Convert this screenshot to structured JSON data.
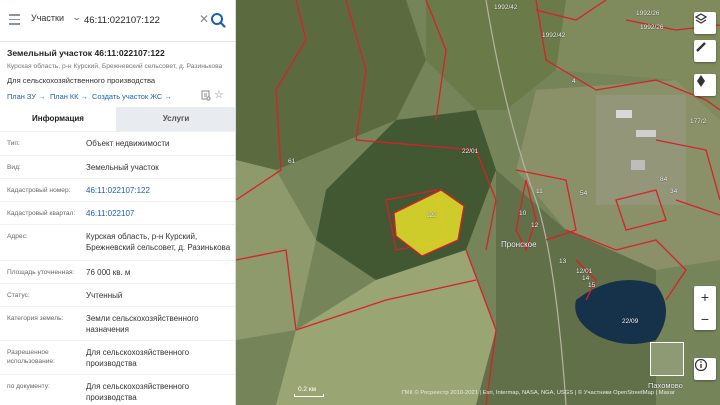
{
  "search": {
    "layer": "Участки",
    "query": "46:11:022107:122"
  },
  "object": {
    "title": "Земельный участок 46:11:022107:122",
    "address": "Курская область, р-н Курский, Брежневский сельсовет, д. Разинькова",
    "purpose": "Для сельскохозяйственного производства",
    "links": [
      "План ЗУ →",
      "План КК →",
      "Создать участок ЖС →"
    ]
  },
  "tabs": [
    "Информация",
    "Услуги"
  ],
  "properties": [
    {
      "label": "Тип:",
      "value": "Объект недвижимости"
    },
    {
      "label": "Вид:",
      "value": "Земельный участок"
    },
    {
      "label": "Кадастровый номер:",
      "value": "46:11:022107:122"
    },
    {
      "label": "Кадастровый квартал:",
      "value": "46:11:022107"
    },
    {
      "label": "Адрес:",
      "value": "Курская область, р-н Курский, Брежневский сельсовет, д. Разинькова"
    },
    {
      "label": "Площадь уточненная:",
      "value": "76 000 кв. м"
    },
    {
      "label": "Статус:",
      "value": "Учтенный"
    },
    {
      "label": "Категория земель:",
      "value": "Земли сельскохозяйственного назначения"
    },
    {
      "label": "Разрешенное использование:",
      "value": "Для сельскохозяйственного производства"
    },
    {
      "label": "по документу:",
      "value": "Для сельскохозяйственного производства"
    }
  ],
  "map": {
    "parcel_labels": [
      "1992/42",
      "1992/42",
      "1992/26",
      "1992/26",
      "61",
      "22/01",
      "11",
      "10",
      "12",
      "13",
      "14",
      "15",
      "54",
      "34",
      "84",
      "177/2",
      "4",
      "122",
      "Пронское",
      "12/01",
      "22/09",
      "Пахомово"
    ],
    "scale": "0.2 км",
    "attribution": "ПКК © Росреестр 2010-2021 | Esri, Intermap, NASA, NGA, USGS | © Участники OpenStreetMap | Maxar",
    "mini_map_label": "Пахомово",
    "colors": {
      "parcel_border": "#d8202a",
      "selected_fill": "#e6e02a",
      "link": "#1a5fb4"
    }
  }
}
